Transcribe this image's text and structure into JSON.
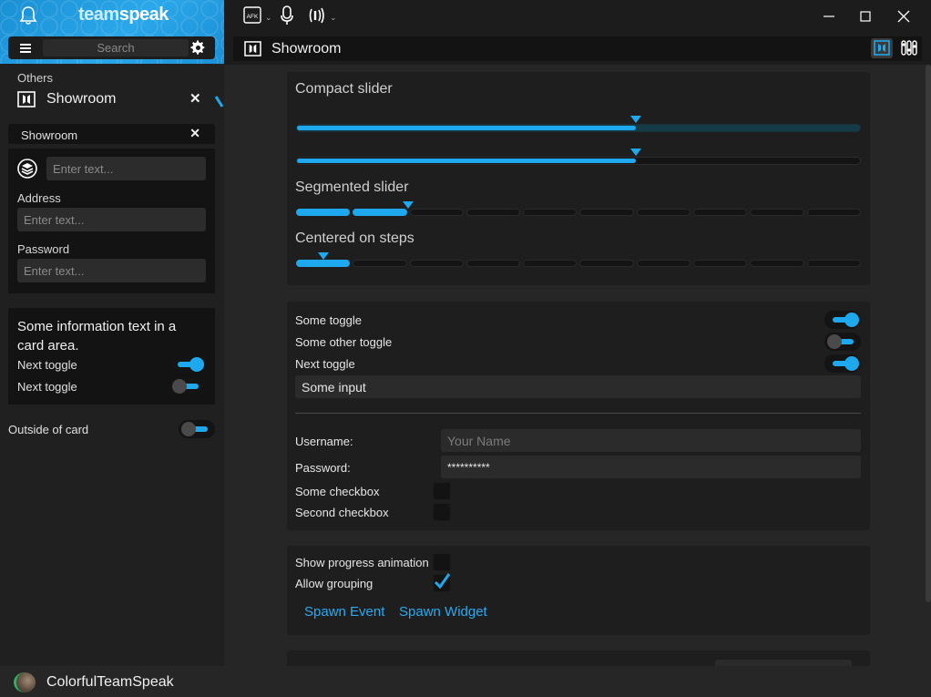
{
  "app": {
    "logo_light": "team",
    "logo_bold": "speak",
    "accent": "#1ea8ee"
  },
  "sidebar": {
    "search": {
      "placeholder": "Search"
    },
    "section_label": "Others",
    "active_item": {
      "label": "Showroom"
    },
    "mini_tab": {
      "label": "Showroom"
    },
    "form": {
      "text_placeholder": "Enter text...",
      "address_label": "Address",
      "address_placeholder": "Enter text...",
      "password_label": "Password",
      "password_placeholder": "Enter text..."
    },
    "info_card": {
      "text": "Some information text in a card area.",
      "toggle1_label": "Next toggle",
      "toggle1_on": true,
      "toggle2_label": "Next toggle",
      "toggle2_on": false
    },
    "outside": {
      "label": "Outside of card",
      "on": false
    }
  },
  "topbar": {
    "afk_label": "AFK"
  },
  "header": {
    "title": "Showroom"
  },
  "sliders": {
    "compact_label": "Compact slider",
    "compact_values": [
      0.6,
      0.6
    ],
    "segmented_label": "Segmented slider",
    "segmented_segments": 10,
    "segmented_filled": 2,
    "centered_label": "Centered on steps",
    "centered_filled": 1
  },
  "settings": {
    "toggles": [
      {
        "label": "Some toggle",
        "on": true
      },
      {
        "label": "Some other toggle",
        "on": false
      },
      {
        "label": "Next toggle",
        "on": true
      }
    ],
    "some_input_value": "Some input",
    "username_label": "Username:",
    "username_placeholder": "Your Name",
    "password_label": "Password:",
    "password_value": "**********",
    "checkbox1_label": "Some checkbox",
    "checkbox2_label": "Second checkbox"
  },
  "actions": {
    "progress_label": "Show progress animation",
    "grouping_label": "Allow grouping",
    "grouping_checked": true,
    "spawn_event": "Spawn Event",
    "spawn_widget": "Spawn Widget"
  },
  "footer": {
    "username": "ColorfulTeamSpeak"
  }
}
